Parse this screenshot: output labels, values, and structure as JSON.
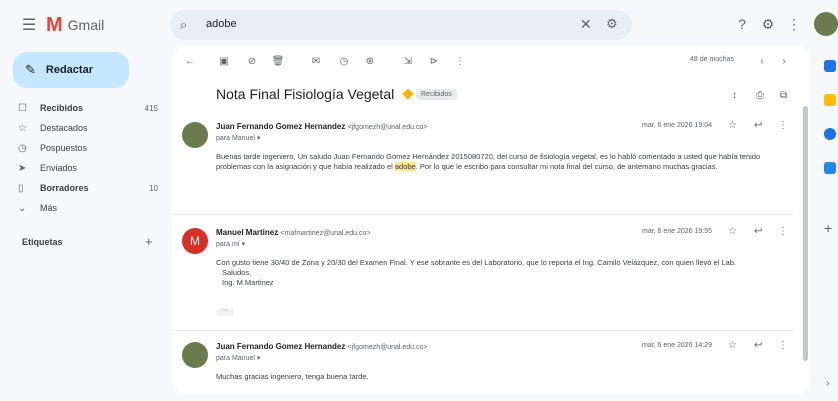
{
  "app": {
    "logo_letter": "M",
    "title": "Gmail"
  },
  "search": {
    "query": "adobe"
  },
  "compose": {
    "label": "Redactar"
  },
  "nav": [
    {
      "icon": "inbox-icon",
      "glyph": "☐",
      "label": "Recibidos",
      "count": "415",
      "bold": true
    },
    {
      "icon": "star-icon",
      "glyph": "☆",
      "label": "Destacados",
      "count": "",
      "bold": false
    },
    {
      "icon": "clock-icon",
      "glyph": "◷",
      "label": "Pospuestos",
      "count": "",
      "bold": false
    },
    {
      "icon": "send-icon",
      "glyph": "➤",
      "label": "Enviados",
      "count": "",
      "bold": false
    },
    {
      "icon": "draft-icon",
      "glyph": "▯",
      "label": "Borradores",
      "count": "10",
      "bold": true
    },
    {
      "icon": "chevron-down-icon",
      "glyph": "⌄",
      "label": "Más",
      "count": "",
      "bold": false
    }
  ],
  "labels": {
    "title": "Etiquetas",
    "add": "+"
  },
  "thread": {
    "pager": "48 de muchas",
    "subject": "Nota Final Fisiología Vegetal",
    "label": "Recibidos",
    "messages": [
      {
        "sender": "Juan Fernando Gomez Hernandez",
        "email": "<jfgomezh@unal.edu.co>",
        "to": "para Manuel ▾",
        "date": "mar, 6 ene 2026 19:04",
        "avatar_color": "#6a7b4e",
        "avatar_letter": "",
        "body_before": "Buenas tarde ingeniero, Un saludo Juan Fernando Gomez Hernández 2015080720, del curso de fisiología vegetal, es lo habló comentado a usted que había tenido problemas con la asignación y que había realizado el",
        "highlight": "adobe",
        "body_after": ". Por lo que le escribo para consultar mi nota final del curso, de antemano muchas gracias.",
        "extra": []
      },
      {
        "sender": "Manuel Martinez",
        "email": "<mafmartinez@unal.edu.co>",
        "to": "para mí ▾",
        "date": "mar, 6 ene 2026 19:55",
        "avatar_color": "#d93025",
        "avatar_letter": "M",
        "body_before": "Con gusto tiene 30/40 de Zona y 20/30 del Examen Final. Y ese sobrante es del Laboratorio, que lo reporta el Ing. Camilo Velázquez, con quien llevó el Lab.",
        "highlight": "",
        "body_after": "",
        "extra": [
          "Saludos,",
          "Ing. M.Martinez"
        ]
      },
      {
        "sender": "Juan Fernando Gomez Hernandez",
        "email": "<jfgomezh@unal.edu.co>",
        "to": "para Manuel ▾",
        "date": "mar, 6 ene 2026 14:29",
        "avatar_color": "#6a7b4e",
        "avatar_letter": "",
        "body_before": "Muchas gracias ingeniero, tenga buena tarde.",
        "highlight": "",
        "body_after": "",
        "extra": []
      }
    ]
  }
}
